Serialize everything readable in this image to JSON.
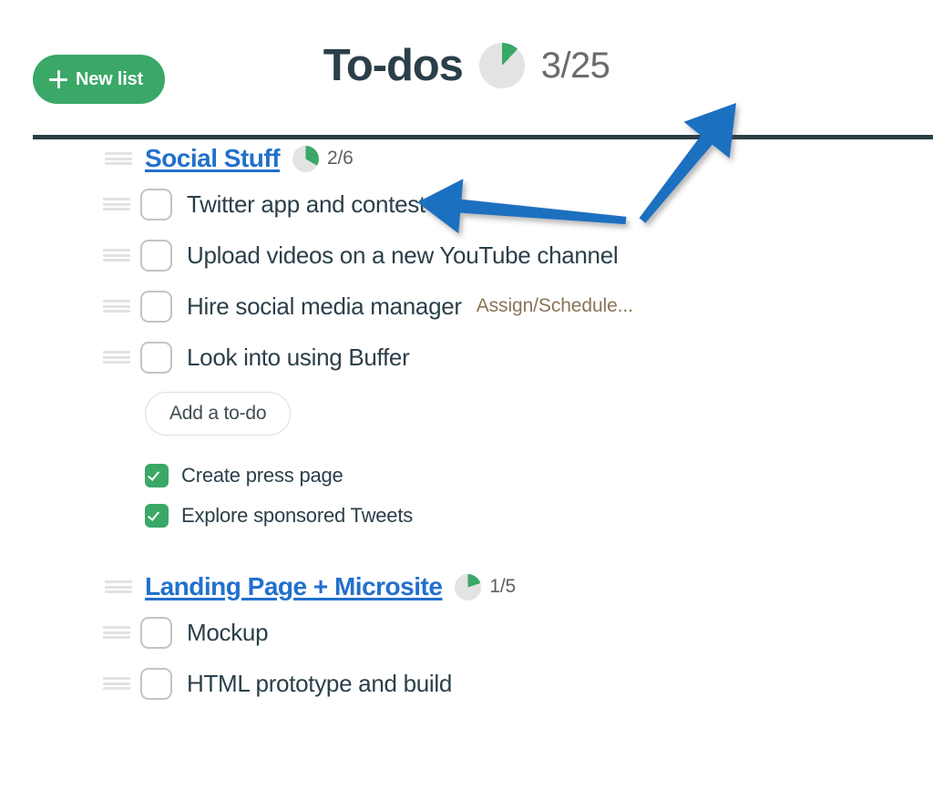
{
  "colors": {
    "brand_green": "#3aa867",
    "link_blue": "#2270cc",
    "heading_slate": "#2b3f49",
    "divider_slate": "#2c3e47",
    "pie_track_gray": "#e3e3e3",
    "assign_brown": "#8a7358",
    "annotation_blue": "#1f6fc0",
    "grip_gray": "#e2e2e2",
    "checkbox_border_gray": "#c0c4c6"
  },
  "header": {
    "new_list_label": "New list",
    "new_list_icon": "plus-icon",
    "title": "To-dos",
    "progress_count": "3/25",
    "progress_done": 3,
    "progress_total": 25,
    "progress_icon": "pie-progress-icon"
  },
  "lists": [
    {
      "title": "Social Stuff",
      "count": "2/6",
      "done": 2,
      "total": 6,
      "grip_icon": "drag-handle-icon",
      "todos": [
        {
          "label": "Twitter app and contest",
          "checked": false,
          "meta": null
        },
        {
          "label": "Upload videos on a new YouTube channel",
          "checked": false,
          "meta": null
        },
        {
          "label": "Hire social media manager",
          "checked": false,
          "meta": "Assign/Schedule..."
        },
        {
          "label": "Look into using Buffer",
          "checked": false,
          "meta": null
        }
      ],
      "add_todo_label": "Add a to-do",
      "completed": [
        {
          "label": "Create press page",
          "checked": true
        },
        {
          "label": "Explore sponsored Tweets",
          "checked": true
        }
      ]
    },
    {
      "title": "Landing Page + Microsite",
      "count": "1/5",
      "done": 1,
      "total": 5,
      "grip_icon": "drag-handle-icon",
      "todos": [
        {
          "label": "Mockup",
          "checked": false,
          "meta": null
        },
        {
          "label": "HTML prototype and build",
          "checked": false,
          "meta": null
        }
      ],
      "add_todo_label": null,
      "completed": []
    }
  ],
  "annotations": [
    {
      "name": "arrow-pointing-to-list-progress",
      "shape": "left-arrow",
      "tip": [
        458,
        222
      ],
      "tail": [
        687,
        242
      ]
    },
    {
      "name": "arrow-pointing-to-total-progress",
      "shape": "up-right-arrow",
      "tip": [
        808,
        113
      ],
      "tail": [
        705,
        242
      ]
    }
  ]
}
